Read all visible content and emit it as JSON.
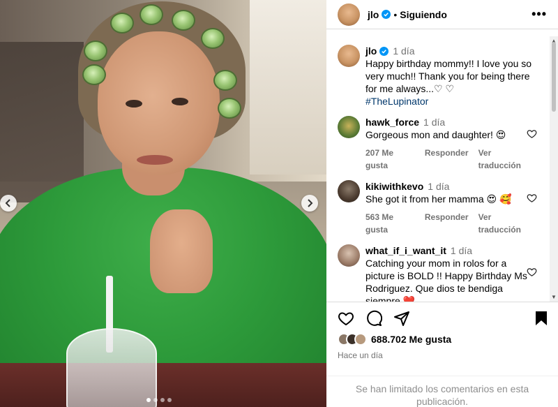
{
  "post": {
    "username": "jlo",
    "follow_status": "Siguiendo",
    "more_icon": "more-horizontal-icon",
    "caption": {
      "username": "jlo",
      "time": "1 día",
      "text": "Happy birthday mommy!! I love you so very much!! Thank you for being there for me always...♡ ♡",
      "hashtag": "#TheLupinator"
    },
    "comments": [
      {
        "username": "hawk_force",
        "time": "1 día",
        "text": "Gorgeous mon and daughter! 😍",
        "likes": "207 Me gusta",
        "reply": "Responder",
        "translate": "Ver traducción"
      },
      {
        "username": "kikiwithkevo",
        "time": "1 día",
        "text": "She got it from her mamma 😍 🥰",
        "likes": "563 Me gusta",
        "reply": "Responder",
        "translate": "Ver traducción"
      },
      {
        "username": "what_if_i_want_it",
        "time": "1 día",
        "text": "Catching your mom in rolos for a picture is BOLD !! Happy Birthday Ms Rodriguez. Que dios te bendiga siempre ❤️"
      }
    ],
    "likes_count": "688.702 Me gusta",
    "time_ago": "Hace un día",
    "comments_limited": "Se han limitado los comentarios en esta publicación.",
    "carousel": {
      "slides": 4,
      "active_index": 0
    }
  },
  "colors": {
    "verified": "#0095f6",
    "hashtag": "#00376b",
    "muted": "#737373",
    "border": "#dbdbdb"
  }
}
